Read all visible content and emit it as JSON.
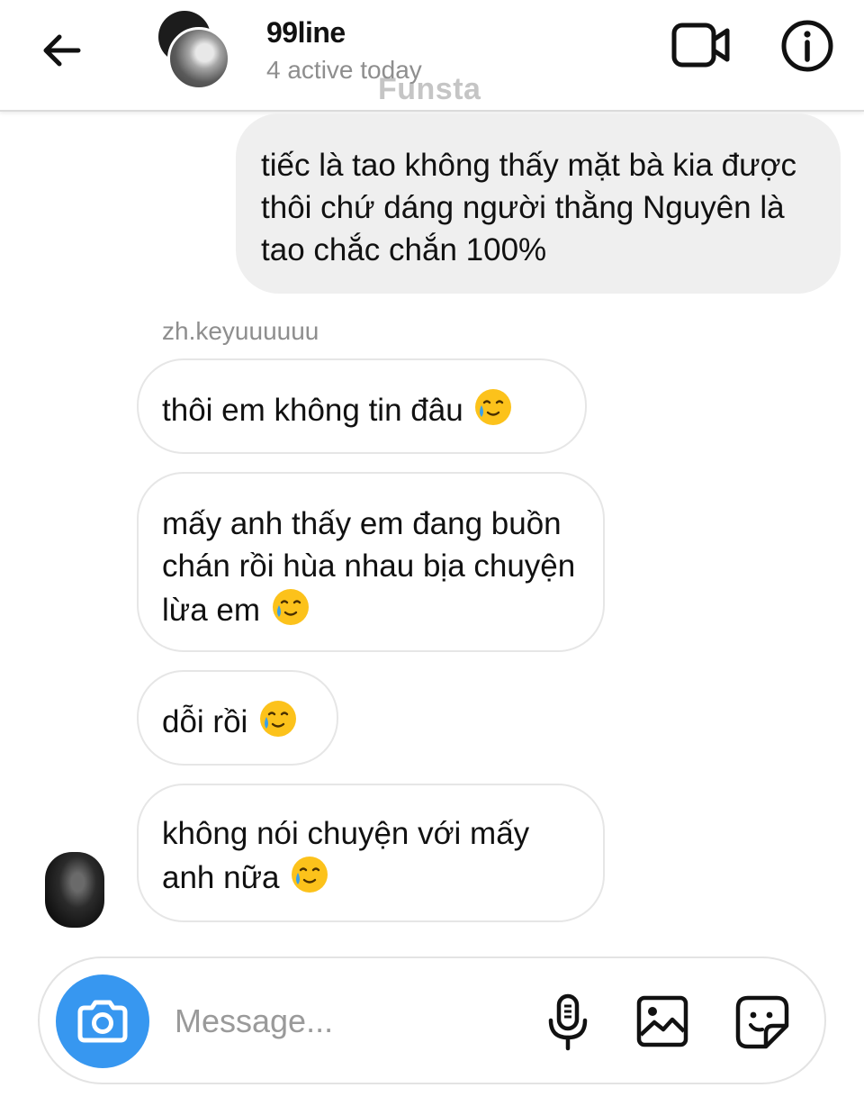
{
  "header": {
    "name": "99line",
    "status": "4 active today",
    "watermark": "Funsta",
    "back_icon": "arrow-left-icon",
    "video_icon": "video-call-icon",
    "info_icon": "info-icon"
  },
  "messages": [
    {
      "from": "me",
      "text": "tiếc là tao không thấy mặt bà kia được thôi chứ dáng người thằng Nguyên là tao chắc chắn 100%"
    },
    {
      "from": "zh.keyuuuuuu",
      "text": "thôi em không tin đâu",
      "emoji": "smiling-face-with-tear"
    },
    {
      "from": "zh.keyuuuuuu",
      "text": "mấy anh thấy em đang buồn chán rồi hùa nhau bịa chuyện lừa em",
      "emoji": "smiling-face-with-tear"
    },
    {
      "from": "zh.keyuuuuuu",
      "text": "dỗi rồi",
      "emoji": "smiling-face-with-tear"
    },
    {
      "from": "zh.keyuuuuuu",
      "text": "không nói chuyện với mấy anh nữa",
      "emoji": "smiling-face-with-tear"
    }
  ],
  "sender_label": "zh.keyuuuuuu",
  "composer": {
    "placeholder": "Message...",
    "value": "",
    "camera_icon": "camera-icon",
    "mic_icon": "microphone-icon",
    "gallery_icon": "gallery-icon",
    "sticker_icon": "sticker-icon"
  },
  "colors": {
    "accent": "#3797f0",
    "sent_bubble": "#efefef",
    "muted_text": "#8e8e8e"
  }
}
